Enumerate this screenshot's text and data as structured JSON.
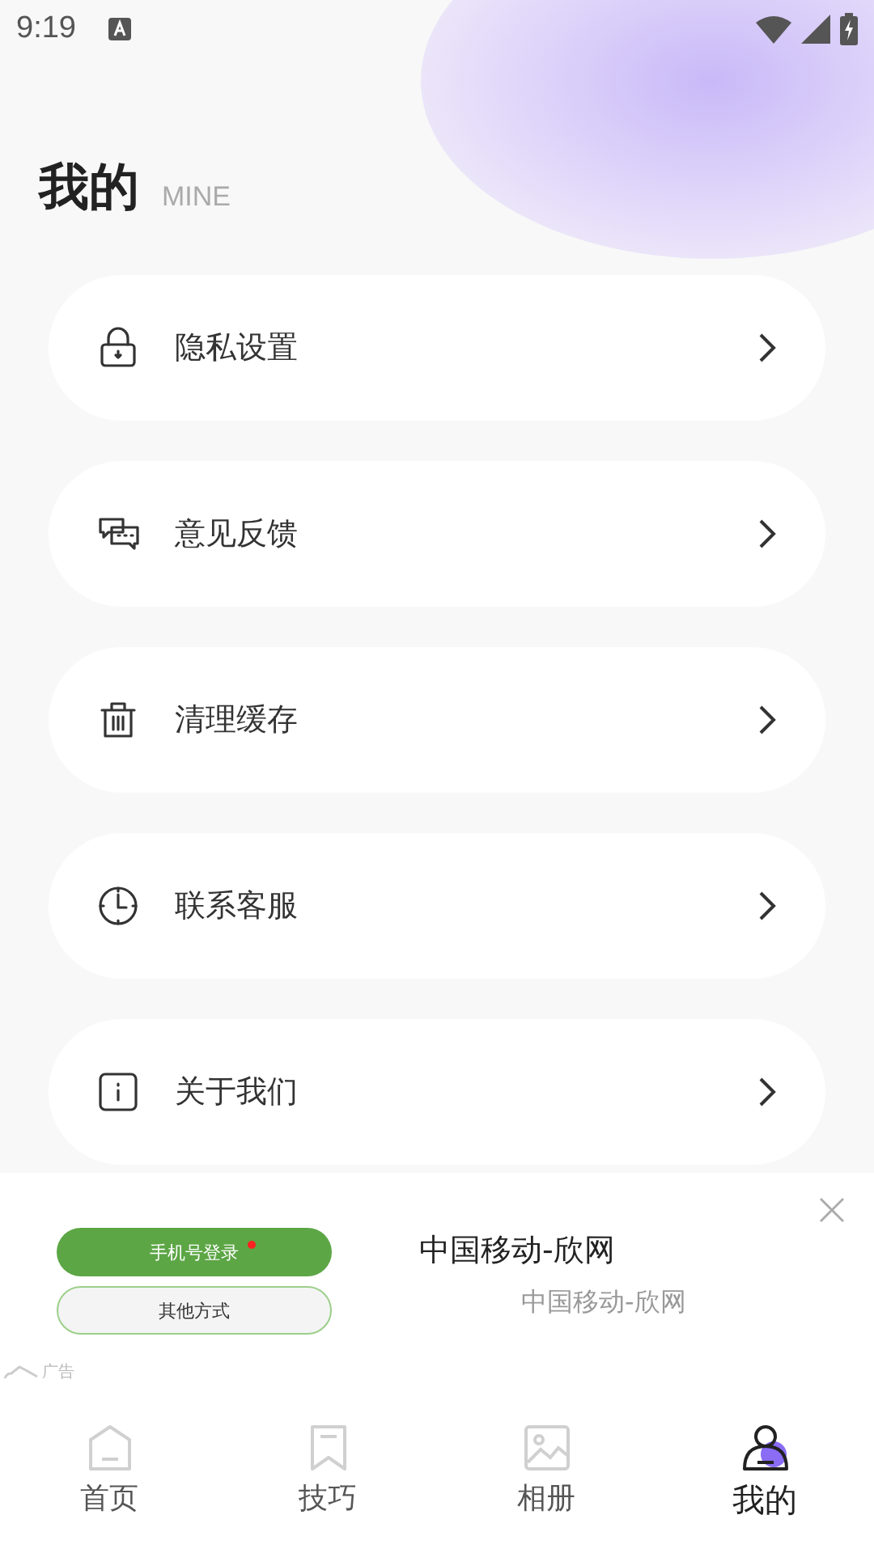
{
  "status_bar": {
    "time": "9:19"
  },
  "header": {
    "title": "我的",
    "subtitle": "MINE"
  },
  "menu": [
    {
      "label": "隐私设置"
    },
    {
      "label": "意见反馈"
    },
    {
      "label": "清理缓存"
    },
    {
      "label": "联系客服"
    },
    {
      "label": "关于我们"
    }
  ],
  "ad": {
    "primary_button": "手机号登录",
    "secondary_button": "其他方式",
    "title": "中国移动-欣网",
    "subtitle": "中国移动-欣网",
    "ad_label": "广告"
  },
  "tabs": [
    {
      "label": "首页",
      "selected": false
    },
    {
      "label": "技巧",
      "selected": false
    },
    {
      "label": "相册",
      "selected": false
    },
    {
      "label": "我的",
      "selected": true
    }
  ]
}
